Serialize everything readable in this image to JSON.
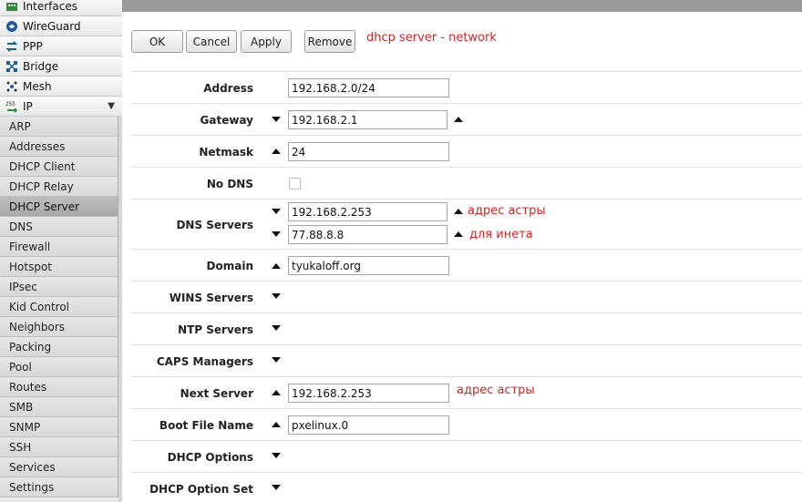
{
  "sidebar": {
    "top_items": [
      {
        "label": "Interfaces",
        "icon": "interfaces-icon"
      },
      {
        "label": "WireGuard",
        "icon": "wireguard-icon"
      },
      {
        "label": "PPP",
        "icon": "ppp-icon"
      },
      {
        "label": "Bridge",
        "icon": "bridge-icon"
      },
      {
        "label": "Mesh",
        "icon": "mesh-icon"
      },
      {
        "label": "IP",
        "icon": "ip-icon",
        "expand": "▼"
      }
    ],
    "ip_items": [
      "ARP",
      "Addresses",
      "DHCP Client",
      "DHCP Relay",
      "DHCP Server",
      "DNS",
      "Firewall",
      "Hotspot",
      "IPsec",
      "Kid Control",
      "Neighbors",
      "Packing",
      "Pool",
      "Routes",
      "SMB",
      "SNMP",
      "SSH",
      "Services",
      "Settings"
    ],
    "active_item": "DHCP Server"
  },
  "toolbar": {
    "ok_label": "OK",
    "cancel_label": "Cancel",
    "apply_label": "Apply",
    "remove_label": "Remove",
    "title": "dhcp server - network"
  },
  "form": {
    "address": {
      "label": "Address",
      "value": "192.168.2.0/24"
    },
    "gateway": {
      "label": "Gateway",
      "value": "192.168.2.1"
    },
    "netmask": {
      "label": "Netmask",
      "value": "24"
    },
    "no_dns": {
      "label": "No DNS",
      "checked": false
    },
    "dns_servers": {
      "label": "DNS Servers",
      "values": [
        "192.168.2.253",
        "77.88.8.8"
      ],
      "notes": [
        "адрес астры",
        "для инета"
      ]
    },
    "domain": {
      "label": "Domain",
      "value": "tyukaloff.org"
    },
    "wins_servers": {
      "label": "WINS Servers"
    },
    "ntp_servers": {
      "label": "NTP Servers"
    },
    "caps_managers": {
      "label": "CAPS Managers"
    },
    "next_server": {
      "label": "Next Server",
      "value": "192.168.2.253",
      "note": "адрес астры"
    },
    "boot_file_name": {
      "label": "Boot File Name",
      "value": "pxelinux.0"
    },
    "dhcp_options": {
      "label": "DHCP Options"
    },
    "dhcp_option_set": {
      "label": "DHCP Option Set"
    }
  },
  "colors": {
    "annotation": "#d62222",
    "active_sidebar": "#b3b3b3"
  }
}
